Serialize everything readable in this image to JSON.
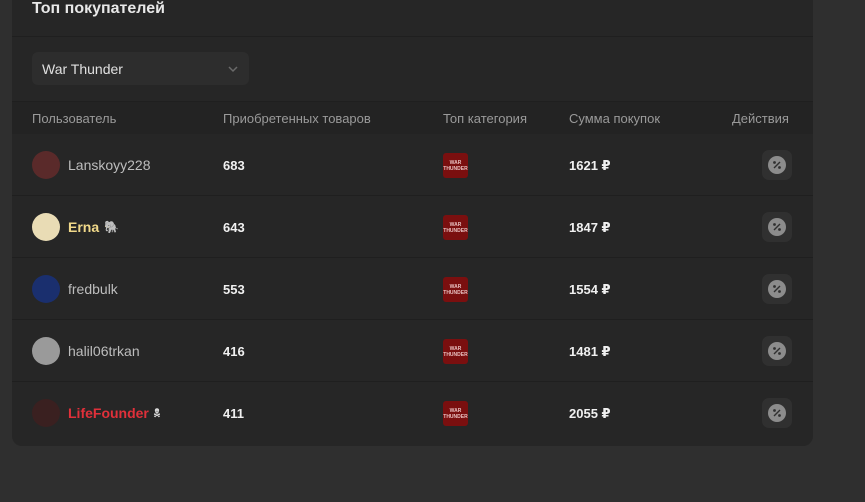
{
  "panel": {
    "title": "Топ покупателей"
  },
  "filter": {
    "selected_game": "War Thunder"
  },
  "table": {
    "headers": {
      "user": "Пользователь",
      "bought": "Приобретенных товаров",
      "category": "Топ категория",
      "sum": "Сумма покупок",
      "actions": "Действия"
    },
    "rows": [
      {
        "user": "Lanskoyy228",
        "bought": "683",
        "sum": "1621 ₽",
        "avatar_color": "#5a2a2a",
        "name_style": "normal",
        "badge": ""
      },
      {
        "user": "Erna",
        "bought": "643",
        "sum": "1847 ₽",
        "avatar_color": "#e9dcb5",
        "name_style": "gold",
        "badge": "🐘"
      },
      {
        "user": "fredbulk",
        "bought": "553",
        "sum": "1554 ₽",
        "avatar_color": "#1a2f6e",
        "name_style": "normal",
        "badge": ""
      },
      {
        "user": "halil06trkan",
        "bought": "416",
        "sum": "1481 ₽",
        "avatar_color": "#9a9a9a",
        "name_style": "normal",
        "badge": ""
      },
      {
        "user": "LifeFounder",
        "bought": "411",
        "sum": "2055 ₽",
        "avatar_color": "#3a2020",
        "name_style": "red",
        "badge": "🕱"
      }
    ]
  },
  "icons": {
    "category": "war-thunder-logo-icon",
    "action": "discount-icon",
    "dropdown": "chevron-down-icon"
  },
  "colors": {
    "category_icon_bg": "#7a0f0f",
    "gold_name": "#f1d98a",
    "red_name": "#e0303a"
  }
}
